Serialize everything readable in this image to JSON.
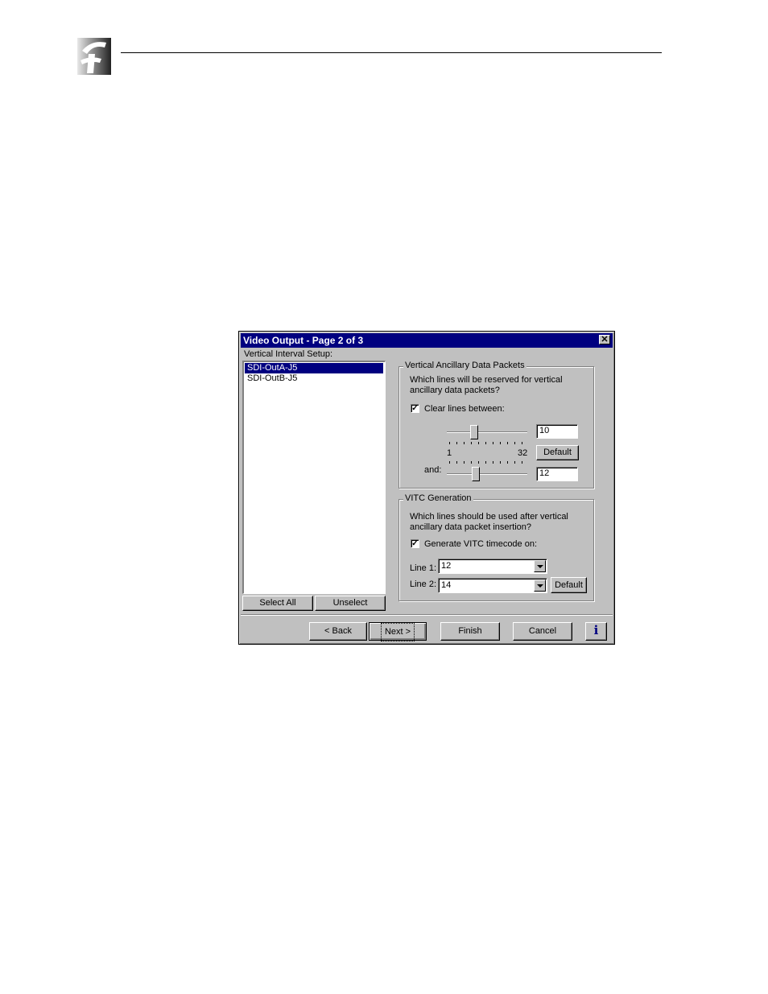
{
  "dialog": {
    "title": "Video Output - Page 2 of 3",
    "close_glyph": "✕",
    "vertical_interval_label": "Vertical Interval Setup:",
    "outputs": [
      {
        "label": "SDI-OutA-J5",
        "selected": true
      },
      {
        "label": "SDI-OutB-J5",
        "selected": false
      }
    ],
    "select_all_label": "Select All",
    "unselect_label": "Unselect",
    "vanc": {
      "group_label": "Vertical Ancillary Data Packets",
      "question_line1": "Which lines will be reserved for vertical",
      "question_line2": "ancillary data packets?",
      "checkbox_label": "Clear lines between:",
      "checked": true,
      "checkmark": "✓",
      "range_min": "1",
      "range_max": "32",
      "start_line": "10",
      "and_label": "and:",
      "end_line": "12",
      "default_label": "Default"
    },
    "vitc": {
      "group_label": "VITC Generation",
      "question_line1": "Which lines should be used after vertical",
      "question_line2": "ancillary data packet insertion?",
      "checkbox_label": "Generate VITC timecode on:",
      "checked": true,
      "checkmark": "✓",
      "line1_label": "Line 1:",
      "line1_value": "12",
      "line2_label": "Line 2:",
      "line2_value": "14",
      "default_label": "Default"
    },
    "nav": {
      "back_label": "< Back",
      "next_label": "Next >",
      "finish_label": "Finish",
      "cancel_label": "Cancel",
      "info_glyph": "i"
    }
  }
}
